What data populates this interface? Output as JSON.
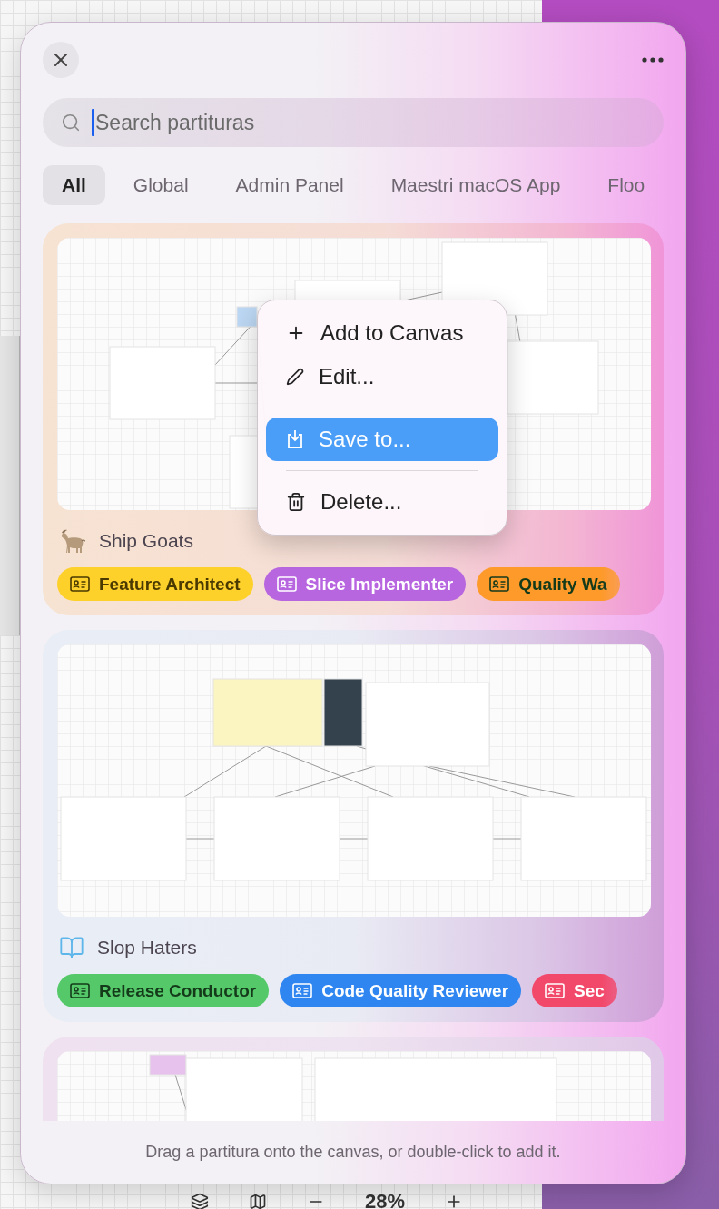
{
  "background": {
    "zoom_toolbar": {
      "zoom": "28%"
    }
  },
  "window": {
    "search": {
      "placeholder": "Search partituras"
    },
    "filters": [
      {
        "label": "All",
        "selected": true
      },
      {
        "label": "Global",
        "selected": false
      },
      {
        "label": "Admin Panel",
        "selected": false
      },
      {
        "label": "Maestri macOS App",
        "selected": false
      },
      {
        "label": "Floo",
        "selected": false
      }
    ],
    "partituras": [
      {
        "kind": "full",
        "name": "Ship Goats",
        "tags": [
          {
            "label": "Feature Architect",
            "color": "#fdd02a"
          },
          {
            "label": "Slice Implementer",
            "color": "#b865e0"
          },
          {
            "label": "Quality Wa",
            "color": "#fd9a2a"
          }
        ]
      },
      {
        "kind": "full",
        "name": "Slop Haters",
        "tags": [
          {
            "label": "Release Conductor",
            "color": "#55c96a"
          },
          {
            "label": "Code Quality Reviewer",
            "color": "#2f86f0"
          },
          {
            "label": "Sec",
            "color": "#f2486a"
          }
        ]
      },
      {
        "kind": "preview_only"
      }
    ],
    "footer": "Drag a partitura onto the canvas, or double-click to add it."
  },
  "context_menu": {
    "items": [
      {
        "kind": "item",
        "label": "Add to Canvas",
        "selected": false
      },
      {
        "kind": "item",
        "label": "Edit...",
        "selected": false
      },
      {
        "kind": "separator"
      },
      {
        "kind": "item",
        "label": "Save to...",
        "selected": true
      },
      {
        "kind": "separator"
      },
      {
        "kind": "item",
        "label": "Delete...",
        "selected": false
      }
    ]
  }
}
